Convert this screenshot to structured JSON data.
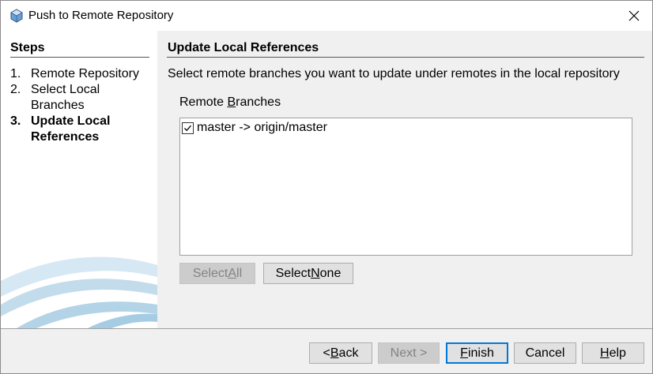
{
  "window": {
    "title": "Push to Remote Repository",
    "close_glyph": "✕"
  },
  "steps": {
    "heading": "Steps",
    "items": [
      {
        "num": "1.",
        "label": "Remote Repository",
        "current": false
      },
      {
        "num": "2.",
        "label": "Select Local Branches",
        "current": false
      },
      {
        "num": "3.",
        "label": "Update Local References",
        "current": true
      }
    ]
  },
  "main": {
    "title": "Update Local References",
    "description": "Select remote branches you want to update under remotes in the local repository",
    "remote_branches_label_pre": "Remote ",
    "remote_branches_label_mnemonic": "B",
    "remote_branches_label_post": "ranches",
    "branches": [
      {
        "label": "master -> origin/master",
        "checked": true
      }
    ],
    "select_all": {
      "pre": "Select ",
      "mnemonic": "A",
      "post": "ll",
      "enabled": false
    },
    "select_none": {
      "pre": "Select ",
      "mnemonic": "N",
      "post": "one",
      "enabled": true
    }
  },
  "footer": {
    "back": {
      "pre": "< ",
      "mnemonic": "B",
      "post": "ack"
    },
    "next": {
      "label": "Next >",
      "enabled": false
    },
    "finish": {
      "pre": "",
      "mnemonic": "F",
      "post": "inish"
    },
    "cancel": {
      "label": "Cancel"
    },
    "help": {
      "pre": "",
      "mnemonic": "H",
      "post": "elp"
    }
  },
  "colors": {
    "default_button_border": "#0078d7",
    "disabled_text": "#838383",
    "swoosh": "#bcd9ea"
  }
}
